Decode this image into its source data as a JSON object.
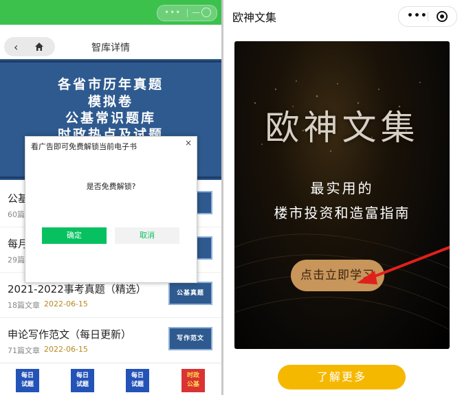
{
  "left": {
    "nav_title": "智库详情",
    "banner_lines": [
      "各省市历年真题",
      "模拟卷",
      "公基常识题库",
      "时政热点及试题"
    ],
    "items": [
      {
        "title": "公基",
        "count": "60篇",
        "date": "",
        "thumb": "识"
      },
      {
        "title": "每月",
        "count": "29篇",
        "date": "",
        "thumb": "时政"
      },
      {
        "title": "2021-2022事考真题（精选）",
        "count": "18篇文章",
        "date": "2022-06-15",
        "thumb": "公基真题"
      },
      {
        "title": "申论写作范文（每日更新）",
        "count": "71篇文章",
        "date": "2022-06-15",
        "thumb": "写作范文"
      }
    ],
    "tabs": [
      {
        "line1": "每日",
        "line2": "试题"
      },
      {
        "line1": "每日",
        "line2": "试题"
      },
      {
        "line1": "每日",
        "line2": "试题"
      },
      {
        "line1": "时政",
        "line2": "公基"
      }
    ],
    "modal": {
      "title": "看广告即可免费解锁当前电子书",
      "close": "×",
      "body": "是否免费解锁?",
      "ok": "确定",
      "cancel": "取消"
    }
  },
  "right": {
    "title": "欧神文集",
    "poster_title": "欧神文集",
    "poster_sub1": "最实用的",
    "poster_sub2": "楼市投资和造富指南",
    "poster_button": "点击立即学习",
    "more_button": "了解更多",
    "colors": {
      "accent": "#f5b800",
      "poster_button": "#c8955a",
      "arrow": "#e0201c"
    }
  }
}
